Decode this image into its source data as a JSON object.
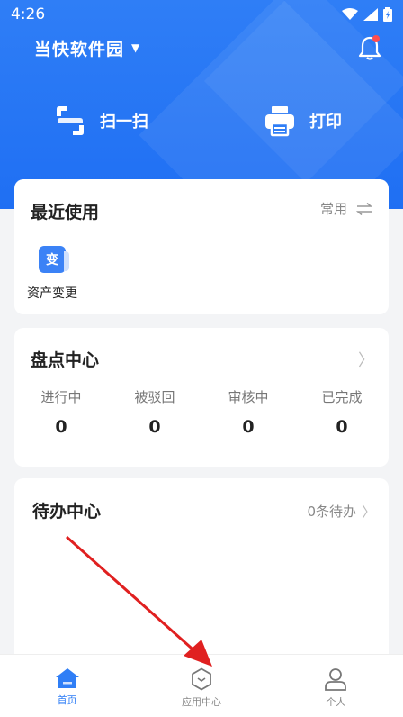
{
  "status_bar": {
    "time": "4:26"
  },
  "header": {
    "org_name": "当快软件园"
  },
  "quick_actions": [
    {
      "label": "扫一扫",
      "icon": "scan-icon"
    },
    {
      "label": "打印",
      "icon": "printer-icon"
    }
  ],
  "recent": {
    "title": "最近使用",
    "link_label": "常用",
    "apps": [
      {
        "icon_text": "变",
        "label": "资产变更"
      }
    ]
  },
  "inventory": {
    "title": "盘点中心",
    "stats": [
      {
        "label": "进行中",
        "value": "0"
      },
      {
        "label": "被驳回",
        "value": "0"
      },
      {
        "label": "审核中",
        "value": "0"
      },
      {
        "label": "已完成",
        "value": "0"
      }
    ]
  },
  "todo": {
    "title": "待办中心",
    "count_label": "0条待办"
  },
  "tabs": [
    {
      "label": "首页",
      "icon": "home-icon",
      "active": true
    },
    {
      "label": "应用中心",
      "icon": "app-center-icon",
      "active": false
    },
    {
      "label": "个人",
      "icon": "person-icon",
      "active": false
    }
  ],
  "colors": {
    "primary": "#2f7ef6",
    "annotation_arrow": "#e02020"
  }
}
